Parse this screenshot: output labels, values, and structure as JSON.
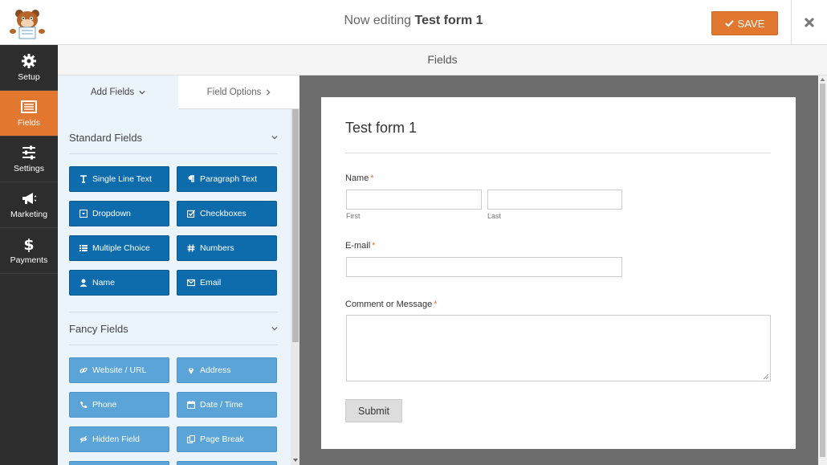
{
  "header": {
    "title_prefix": "Now editing",
    "form_name": "Test form 1",
    "save_label": "SAVE"
  },
  "nav": {
    "items": [
      {
        "label": "Setup",
        "icon": "gear-icon"
      },
      {
        "label": "Fields",
        "icon": "list-icon",
        "active": true
      },
      {
        "label": "Settings",
        "icon": "sliders-icon"
      },
      {
        "label": "Marketing",
        "icon": "megaphone-icon"
      },
      {
        "label": "Payments",
        "icon": "dollar-icon"
      }
    ]
  },
  "section_header": "Fields",
  "panel": {
    "tabs": {
      "add_fields": "Add Fields",
      "field_options": "Field Options"
    },
    "standard": {
      "title": "Standard Fields",
      "buttons": [
        "Single Line Text",
        "Paragraph Text",
        "Dropdown",
        "Checkboxes",
        "Multiple Choice",
        "Numbers",
        "Name",
        "Email"
      ]
    },
    "fancy": {
      "title": "Fancy Fields",
      "buttons": [
        "Website / URL",
        "Address",
        "Phone",
        "Date / Time",
        "Hidden Field",
        "Page Break"
      ]
    }
  },
  "form": {
    "title": "Test form 1",
    "name_label": "Name",
    "first_label": "First",
    "last_label": "Last",
    "email_label": "E-mail",
    "comment_label": "Comment or Message",
    "required_mark": "*",
    "submit_label": "Submit"
  },
  "colors": {
    "accent": "#e27730",
    "nav_bg": "#2d2d2d",
    "standard_button": "#0e6cad",
    "fancy_button": "#5aa4d7",
    "panel_bg": "#ebf3fb",
    "preview_bg": "#6d6d6d"
  }
}
